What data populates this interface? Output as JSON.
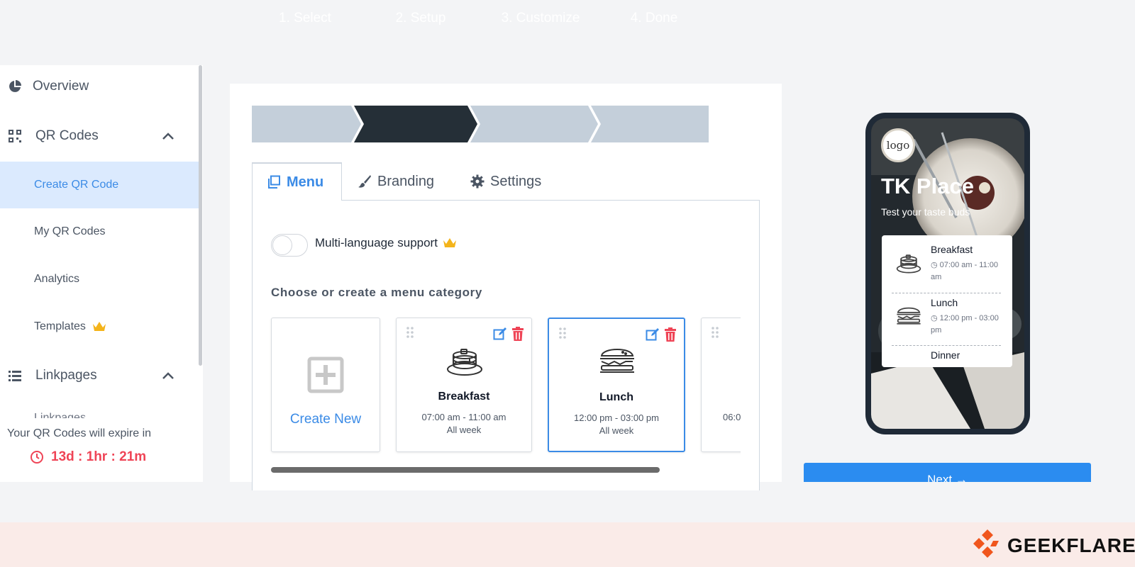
{
  "sidebar": {
    "overview": "Overview",
    "qr_codes": "QR Codes",
    "create_qr": "Create QR Code",
    "my_qr": "My QR Codes",
    "analytics": "Analytics",
    "templates": "Templates",
    "linkpages": "Linkpages",
    "linkpages_sub": "Linkpages",
    "expire_text": "Your QR Codes will expire in",
    "countdown": "13d : 1hr : 21m"
  },
  "stepper": {
    "steps": [
      "1. Select",
      "2. Setup",
      "3. Customize",
      "4. Done"
    ],
    "active_index": 1
  },
  "tabs": {
    "menu": "Menu",
    "branding": "Branding",
    "settings": "Settings"
  },
  "multi_language": {
    "label": "Multi-language support",
    "enabled": false
  },
  "section_title": "Choose or create a menu category",
  "create_new": "Create New",
  "categories": [
    {
      "name": "Breakfast",
      "time": "07:00 am - 11:00 am",
      "days": "All week"
    },
    {
      "name": "Lunch",
      "time": "12:00 pm - 03:00 pm",
      "days": "All week"
    },
    {
      "name": "",
      "time": "06:0",
      "days": ""
    }
  ],
  "preview": {
    "logo": "logo",
    "title": "TK Place",
    "subtitle": "Test your taste buds",
    "items": [
      {
        "name": "Breakfast",
        "time": "07:00 am - 11:00 am"
      },
      {
        "name": "Lunch",
        "time": "12:00 pm - 03:00 pm"
      },
      {
        "name": "Dinner",
        "time": ""
      }
    ]
  },
  "next_button": "Next →",
  "brand": "GEEKFLARE",
  "colors": {
    "accent": "#3b8be6",
    "stepper_active": "#252f37",
    "stepper_inactive": "#c4cfda",
    "danger": "#ef4456",
    "crown": "#f4b41b",
    "brand_orange": "#f0561d"
  }
}
